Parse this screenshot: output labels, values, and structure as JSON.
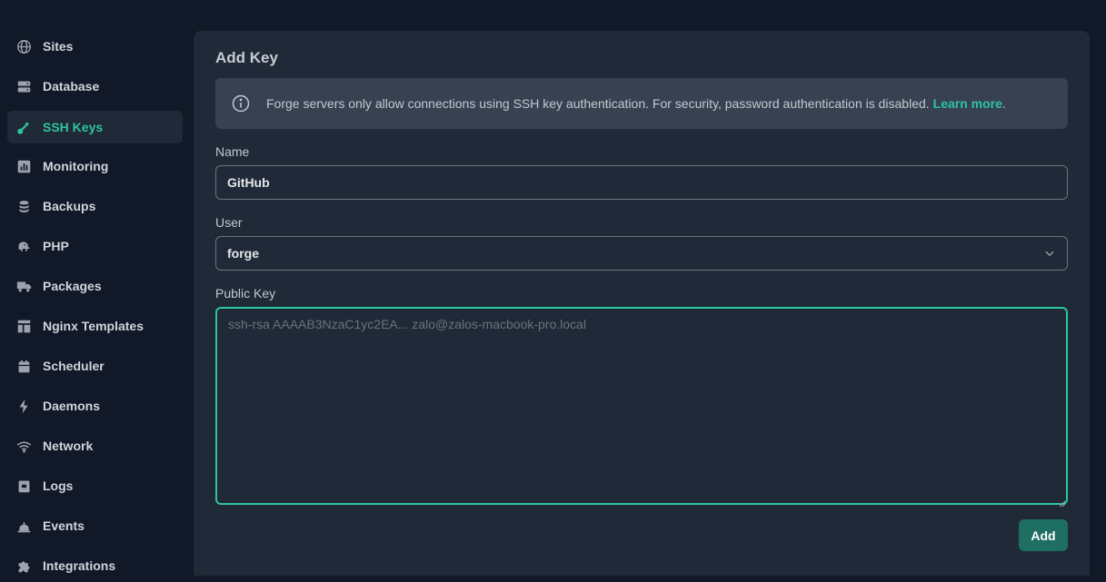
{
  "sidebar": {
    "items": [
      {
        "label": "Sites",
        "icon": "globe-icon"
      },
      {
        "label": "Database",
        "icon": "database-icon"
      },
      {
        "label": "SSH Keys",
        "icon": "key-icon",
        "active": true
      },
      {
        "label": "Monitoring",
        "icon": "chart-icon"
      },
      {
        "label": "Backups",
        "icon": "stack-icon"
      },
      {
        "label": "PHP",
        "icon": "elephant-icon"
      },
      {
        "label": "Packages",
        "icon": "truck-icon"
      },
      {
        "label": "Nginx Templates",
        "icon": "template-icon"
      },
      {
        "label": "Scheduler",
        "icon": "calendar-icon"
      },
      {
        "label": "Daemons",
        "icon": "bolt-icon"
      },
      {
        "label": "Network",
        "icon": "wifi-icon"
      },
      {
        "label": "Logs",
        "icon": "archive-icon"
      },
      {
        "label": "Events",
        "icon": "bell-icon"
      },
      {
        "label": "Integrations",
        "icon": "puzzle-icon"
      }
    ]
  },
  "form": {
    "title": "Add Key",
    "alert": {
      "text": "Forge servers only allow connections using SSH key authentication. For security, password authentication is disabled.",
      "link": "Learn more",
      "period": "."
    },
    "name": {
      "label": "Name",
      "value": "GitHub"
    },
    "user": {
      "label": "User",
      "value": "forge"
    },
    "public_key": {
      "label": "Public Key",
      "placeholder": "ssh-rsa AAAAB3NzaC1yc2EA... zalo@zalos-macbook-pro.local",
      "value": ""
    },
    "submit_label": "Add"
  },
  "colors": {
    "accent": "#2ec4a0",
    "button": "#1f6e62",
    "background": "#111827",
    "panel": "#1f2937"
  }
}
